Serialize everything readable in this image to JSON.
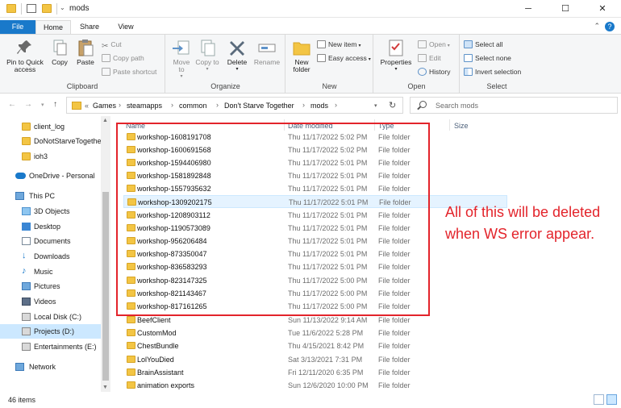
{
  "window": {
    "title": "mods",
    "minimize": "─",
    "maximize": "☐",
    "close": "✕"
  },
  "tabs": {
    "file": "File",
    "home": "Home",
    "share": "Share",
    "view": "View"
  },
  "ribbon": {
    "clipboard": {
      "label": "Clipboard",
      "pin": "Pin to Quick access",
      "copy": "Copy",
      "paste": "Paste",
      "cut": "Cut",
      "copy_path": "Copy path",
      "paste_shortcut": "Paste shortcut"
    },
    "organize": {
      "label": "Organize",
      "move_to": "Move to",
      "copy_to": "Copy to",
      "delete": "Delete",
      "rename": "Rename"
    },
    "new": {
      "label": "New",
      "new_folder": "New folder",
      "new_item": "New item",
      "easy_access": "Easy access"
    },
    "open": {
      "label": "Open",
      "properties": "Properties",
      "open": "Open",
      "edit": "Edit",
      "history": "History"
    },
    "select": {
      "label": "Select",
      "select_all": "Select all",
      "select_none": "Select none",
      "invert": "Invert selection"
    }
  },
  "address": {
    "overflow": "«",
    "crumbs": [
      "Games",
      "steamapps",
      "common",
      "Don't Starve Together",
      "mods"
    ],
    "search_placeholder": "Search mods"
  },
  "nav": [
    "client_log",
    "DoNotStarveTogether",
    "ioh3",
    "OneDrive - Personal",
    "This PC",
    "3D Objects",
    "Desktop",
    "Documents",
    "Downloads",
    "Music",
    "Pictures",
    "Videos",
    "Local Disk (C:)",
    "Projects (D:)",
    "Entertainments (E:)",
    "Network"
  ],
  "columns": {
    "name": "Name",
    "date": "Date modified",
    "type": "Type",
    "size": "Size"
  },
  "files": [
    {
      "name": "workshop-1608191708",
      "date": "Thu 11/17/2022 5:02 PM",
      "type": "File folder"
    },
    {
      "name": "workshop-1600691568",
      "date": "Thu 11/17/2022 5:02 PM",
      "type": "File folder"
    },
    {
      "name": "workshop-1594406980",
      "date": "Thu 11/17/2022 5:01 PM",
      "type": "File folder"
    },
    {
      "name": "workshop-1581892848",
      "date": "Thu 11/17/2022 5:01 PM",
      "type": "File folder"
    },
    {
      "name": "workshop-1557935632",
      "date": "Thu 11/17/2022 5:01 PM",
      "type": "File folder"
    },
    {
      "name": "workshop-1309202175",
      "date": "Thu 11/17/2022 5:01 PM",
      "type": "File folder"
    },
    {
      "name": "workshop-1208903112",
      "date": "Thu 11/17/2022 5:01 PM",
      "type": "File folder"
    },
    {
      "name": "workshop-1190573089",
      "date": "Thu 11/17/2022 5:01 PM",
      "type": "File folder"
    },
    {
      "name": "workshop-956206484",
      "date": "Thu 11/17/2022 5:01 PM",
      "type": "File folder"
    },
    {
      "name": "workshop-873350047",
      "date": "Thu 11/17/2022 5:01 PM",
      "type": "File folder"
    },
    {
      "name": "workshop-836583293",
      "date": "Thu 11/17/2022 5:01 PM",
      "type": "File folder"
    },
    {
      "name": "workshop-823147325",
      "date": "Thu 11/17/2022 5:00 PM",
      "type": "File folder"
    },
    {
      "name": "workshop-821143467",
      "date": "Thu 11/17/2022 5:00 PM",
      "type": "File folder"
    },
    {
      "name": "workshop-817161265",
      "date": "Thu 11/17/2022 5:00 PM",
      "type": "File folder"
    },
    {
      "name": "BeefClient",
      "date": "Sun 11/13/2022 9:14 AM",
      "type": "File folder"
    },
    {
      "name": "CustomMod",
      "date": "Tue 11/6/2022 5:28 PM",
      "type": "File folder"
    },
    {
      "name": "ChestBundle",
      "date": "Thu 4/15/2021 8:42 PM",
      "type": "File folder"
    },
    {
      "name": "LolYouDied",
      "date": "Sat 3/13/2021 7:31 PM",
      "type": "File folder"
    },
    {
      "name": "BrainAssistant",
      "date": "Fri 12/11/2020 6:35 PM",
      "type": "File folder"
    },
    {
      "name": "animation exports",
      "date": "Sun 12/6/2020 10:00 PM",
      "type": "File folder"
    }
  ],
  "annotation": "All of this will be deleted when WS error appear.",
  "status": {
    "count": "46 items"
  },
  "colors": {
    "accent": "#1979ca",
    "annotation": "#e3242b",
    "folder": "#f3c544",
    "selection": "#cce8ff"
  }
}
